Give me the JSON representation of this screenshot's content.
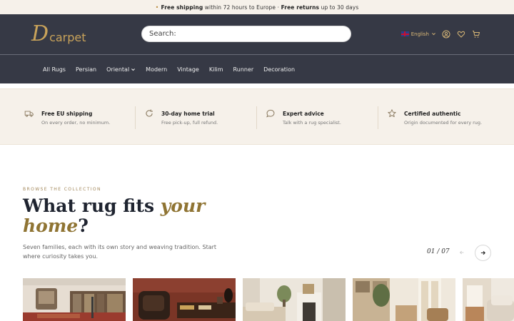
{
  "announcement": {
    "free_shipping_bold": "Free shipping",
    "free_shipping_text": " within 72 hours to Europe · ",
    "free_returns_bold": "Free returns",
    "free_returns_text": " up to 30 days"
  },
  "brand": {
    "initial": "D",
    "word": "carpet",
    "color": "#c9a35a"
  },
  "search": {
    "placeholder": "Search:"
  },
  "header_actions": {
    "language": "English",
    "icons": [
      "flag-uk-icon",
      "chevron-down-icon",
      "user-icon",
      "heart-icon",
      "cart-icon"
    ]
  },
  "nav": {
    "items": [
      "All Rugs",
      "Persian",
      "Oriental",
      "Modern",
      "Vintage",
      "Kilim",
      "Runner",
      "Decoration"
    ],
    "dropdown_item": "Oriental"
  },
  "features": [
    {
      "title": "Free EU shipping",
      "subtitle": "On every order, no minimum.",
      "icon": "truck-icon"
    },
    {
      "title": "30-day home trial",
      "subtitle": "Free pick-up, full refund.",
      "icon": "refresh-icon"
    },
    {
      "title": "Expert advice",
      "subtitle": "Talk with a rug specialist.",
      "icon": "chat-icon"
    },
    {
      "title": "Certified authentic",
      "subtitle": "Origin documented for every rug.",
      "icon": "star-icon"
    }
  ],
  "collection": {
    "eyebrow": "BROWSE THE COLLECTION",
    "headline_part1": "What rug fits ",
    "headline_accent": "your home",
    "headline_part2": "?",
    "description": "Seven families, each with its own story and weaving tradition. Start where curiosity takes you.",
    "pager": "01 / 07"
  },
  "colors": {
    "header_bg": "#363945",
    "accent_gold": "#c9a35a",
    "cream_bg": "#f6f1ea",
    "headline_accent": "#8f7433"
  }
}
